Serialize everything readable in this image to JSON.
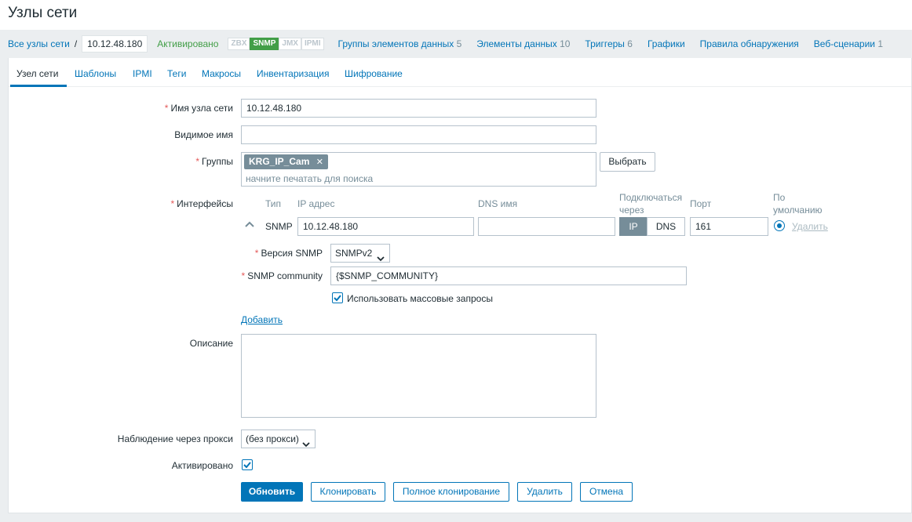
{
  "page": {
    "title": "Узлы сети"
  },
  "nav": {
    "all_hosts": "Все узлы сети",
    "separator": "/",
    "current_host": "10.12.48.180",
    "status": "Активировано",
    "availability": [
      "ZBX",
      "SNMP",
      "JMX",
      "IPMI"
    ],
    "availability_active": "SNMP",
    "links": [
      {
        "label": "Группы элементов данных",
        "count": "5"
      },
      {
        "label": "Элементы данных",
        "count": "10"
      },
      {
        "label": "Триггеры",
        "count": "6"
      },
      {
        "label": "Графики",
        "count": ""
      },
      {
        "label": "Правила обнаружения",
        "count": ""
      },
      {
        "label": "Веб-сценарии",
        "count": "1"
      }
    ]
  },
  "tabs": [
    "Узел сети",
    "Шаблоны",
    "IPMI",
    "Теги",
    "Макросы",
    "Инвентаризация",
    "Шифрование"
  ],
  "active_tab": "Узел сети",
  "form": {
    "required_mark": "*",
    "host_name": {
      "label": "Имя узла сети",
      "value": "10.12.48.180"
    },
    "visible_name": {
      "label": "Видимое имя",
      "value": ""
    },
    "groups": {
      "label": "Группы",
      "tag": "KRG_IP_Cam",
      "placeholder": "начните печатать для поиска",
      "select_button": "Выбрать"
    },
    "interfaces": {
      "label": "Интерфейсы",
      "headers": {
        "type": "Тип",
        "ip": "IP адрес",
        "dns": "DNS имя",
        "connect_line1": "Подключаться",
        "connect_line2": "через",
        "port": "Порт",
        "default_line1": "По",
        "default_line2": "умолчанию"
      },
      "row": {
        "type": "SNMP",
        "ip": "10.12.48.180",
        "dns": "",
        "connect_ip": "IP",
        "connect_dns": "DNS",
        "connect_selected": "IP",
        "port": "161",
        "remove": "Удалить"
      },
      "snmp_version": {
        "label": "Версия SNMP",
        "value": "SNMPv2"
      },
      "snmp_community": {
        "label": "SNMP community",
        "value": "{$SNMP_COMMUNITY}"
      },
      "bulk": {
        "label": "Использовать массовые запросы",
        "checked": true
      },
      "add": "Добавить"
    },
    "description": {
      "label": "Описание",
      "value": ""
    },
    "proxy": {
      "label": "Наблюдение через прокси",
      "value": "(без прокси)"
    },
    "enabled": {
      "label": "Активировано",
      "checked": true
    }
  },
  "buttons": {
    "update": "Обновить",
    "clone": "Клонировать",
    "full_clone": "Полное клонирование",
    "delete": "Удалить",
    "cancel": "Отмена"
  },
  "colors": {
    "link": "#0275b8",
    "active_status": "#429e47",
    "required": "#e45959",
    "muted": "#768d99"
  }
}
